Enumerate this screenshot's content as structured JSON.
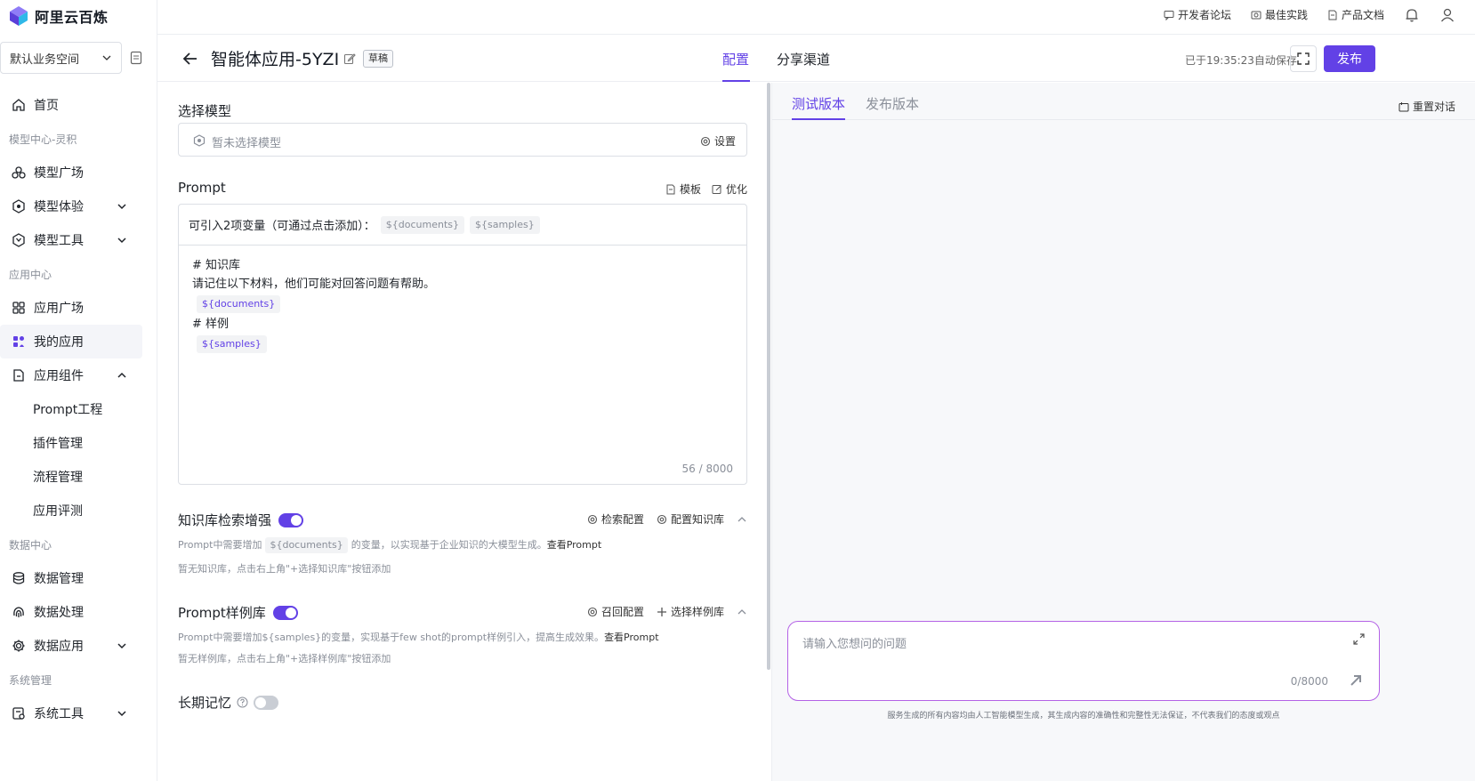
{
  "app": {
    "logo_text": "阿里云百炼",
    "accent": "#6241e6"
  },
  "topbar": {
    "links": [
      {
        "label": "开发者论坛",
        "icon": "forum-icon"
      },
      {
        "label": "最佳实践",
        "icon": "practice-icon"
      },
      {
        "label": "产品文档",
        "icon": "doc-icon"
      }
    ]
  },
  "sidebar": {
    "workspace": "默认业务空间",
    "groups": {
      "model_center": "模型中心-灵积",
      "app_center": "应用中心",
      "data_center": "数据中心",
      "system": "系统管理"
    },
    "items": {
      "home": "首页",
      "model_square": "模型广场",
      "model_exp": "模型体验",
      "model_tools": "模型工具",
      "app_square": "应用广场",
      "my_apps": "我的应用",
      "app_components": "应用组件",
      "prompt_eng": "Prompt工程",
      "plugin_mgmt": "插件管理",
      "flow_mgmt": "流程管理",
      "app_eval": "应用评测",
      "data_mgmt": "数据管理",
      "data_proc": "数据处理",
      "data_app": "数据应用",
      "sys_tools": "系统工具"
    }
  },
  "header": {
    "title": "智能体应用-5YZI",
    "badge": "草稿",
    "tab_config": "配置",
    "tab_share": "分享渠道",
    "autosave": "已于19:35:23自动保存",
    "publish": "发布"
  },
  "config": {
    "model_section": "选择模型",
    "model_placeholder": "暂未选择模型",
    "model_settings": "设置",
    "prompt_section": "Prompt",
    "prompt_template": "模板",
    "prompt_optimize": "优化",
    "var_hint": "可引入2项变量（可通过点击添加）：",
    "var_documents": "${documents}",
    "var_samples": "${samples}",
    "prompt_lines": {
      "l1": "# 知识库",
      "l2": "请记住以下材料，他们可能对回答问题有帮助。",
      "l3": "# 样例"
    },
    "prompt_count": "56 / 8000",
    "kb": {
      "title": "知识库检索增强",
      "enabled": true,
      "retrieval_cfg": "检索配置",
      "kb_cfg": "配置知识库",
      "desc_pre": "Prompt中需要增加",
      "desc_chip": "${documents}",
      "desc_post": "的变量，以实现基于企业知识的大模型生成。",
      "desc_link": "查看Prompt",
      "empty": "暂无知识库，点击右上角\"+选择知识库\"按钮添加"
    },
    "samples": {
      "title": "Prompt样例库",
      "enabled": true,
      "recall_cfg": "召回配置",
      "select_lib": "选择样例库",
      "desc": "Prompt中需要增加${samples}的变量，实现基于few shot的prompt样例引入，提高生成效果。",
      "desc_link": "查看Prompt",
      "empty": "暂无样例库，点击右上角\"+选择样例库\"按钮添加"
    },
    "memory": {
      "title": "长期记忆",
      "enabled": false
    }
  },
  "preview": {
    "tab_test": "测试版本",
    "tab_publish": "发布版本",
    "reset": "重置对话",
    "input_placeholder": "请输入您想问的问题",
    "input_count": "0/8000",
    "disclaimer": "服务生成的所有内容均由人工智能模型生成，其生成内容的准确性和完整性无法保证，不代表我们的态度或观点"
  }
}
